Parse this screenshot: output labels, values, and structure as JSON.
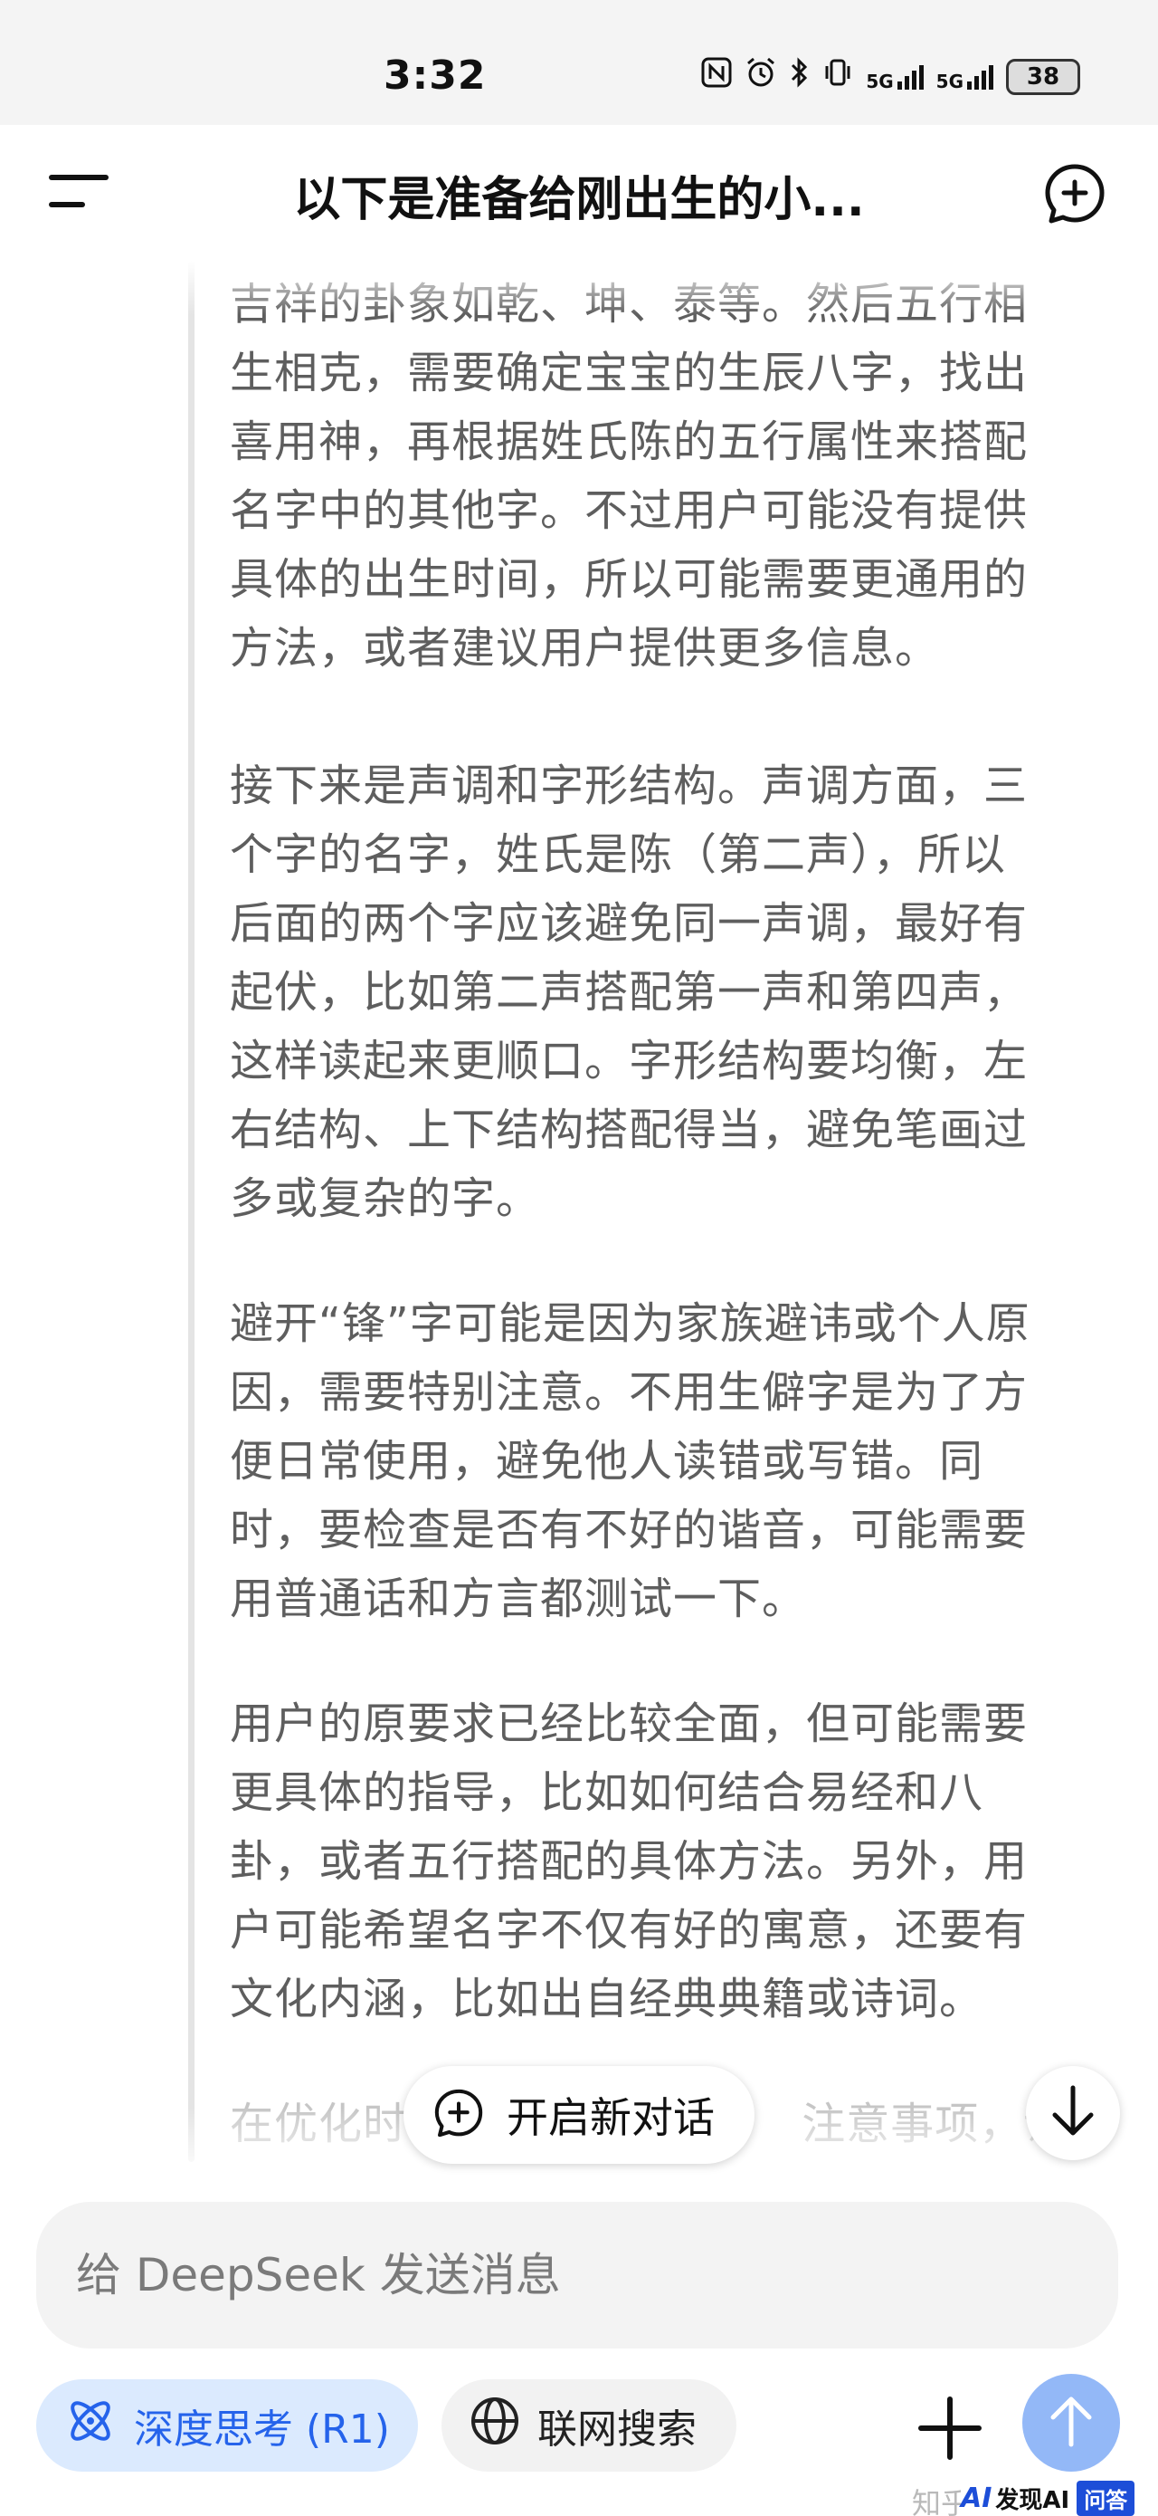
{
  "status_bar": {
    "time": "3:32",
    "network_1": "5G",
    "network_2": "5G",
    "battery": "38",
    "icons": [
      "nfc-icon",
      "alarm-icon",
      "bluetooth-icon",
      "vibrate-icon",
      "signal-icon",
      "signal-icon",
      "battery-icon"
    ]
  },
  "header": {
    "title": "以下是准备给刚出生的小..."
  },
  "content": {
    "paragraphs": [
      {
        "lines": [
          "吉祥的卦象如乾、坤、泰等。然后五行相",
          "生相克，需要确定宝宝的生辰八字，找出",
          "喜用神，再根据姓氏陈的五行属性来搭配",
          "名字中的其他字。不过用户可能没有提供",
          "具体的出生时间，所以可能需要更通用的",
          "方法，或者建议用户提供更多信息。"
        ]
      },
      {
        "lines": [
          "接下来是声调和字形结构。声调方面，三",
          "个字的名字，姓氏是陈（第二声），所以",
          "后面的两个字应该避免同一声调，最好有",
          "起伏，比如第二声搭配第一声和第四声，",
          "这样读起来更顺口。字形结构要均衡，左",
          "右结构、上下结构搭配得当，避免笔画过",
          "多或复杂的字。"
        ]
      },
      {
        "lines": [
          "避开“锋”字可能是因为家族避讳或个人原",
          "因，需要特别注意。不用生僻字是为了方",
          "便日常使用，避免他人读错或写错。同",
          "时，要检查是否有不好的谐音，可能需要",
          "用普通话和方言都测试一下。"
        ]
      },
      {
        "lines": [
          "用户的原要求已经比较全面，但可能需要",
          "更具体的指导，比如如何结合易经和八",
          "卦，或者五行搭配的具体方法。另外，用",
          "户可能希望名字不仅有好的寓意，还要有",
          "文化内涵，比如出自经典典籍或诗词。"
        ]
      },
      {
        "lines": [
          "在优化时",
          "注意事项，让"
        ]
      }
    ]
  },
  "floating": {
    "new_chat_label": "开启新对话"
  },
  "composer": {
    "placeholder": "给 DeepSeek 发送消息",
    "deep_think_label": "深度思考 (R1)",
    "web_search_label": "联网搜索"
  },
  "watermark": {
    "text": "知乎 @momo",
    "badge_ai": "AI",
    "badge_name": "发现AI",
    "badge_tag": "问答"
  },
  "colors": {
    "accent": "#2563eb",
    "chip_active_bg": "#dbeafe",
    "send_button": "#93b8f7",
    "body_text": "#5e5e5e"
  }
}
